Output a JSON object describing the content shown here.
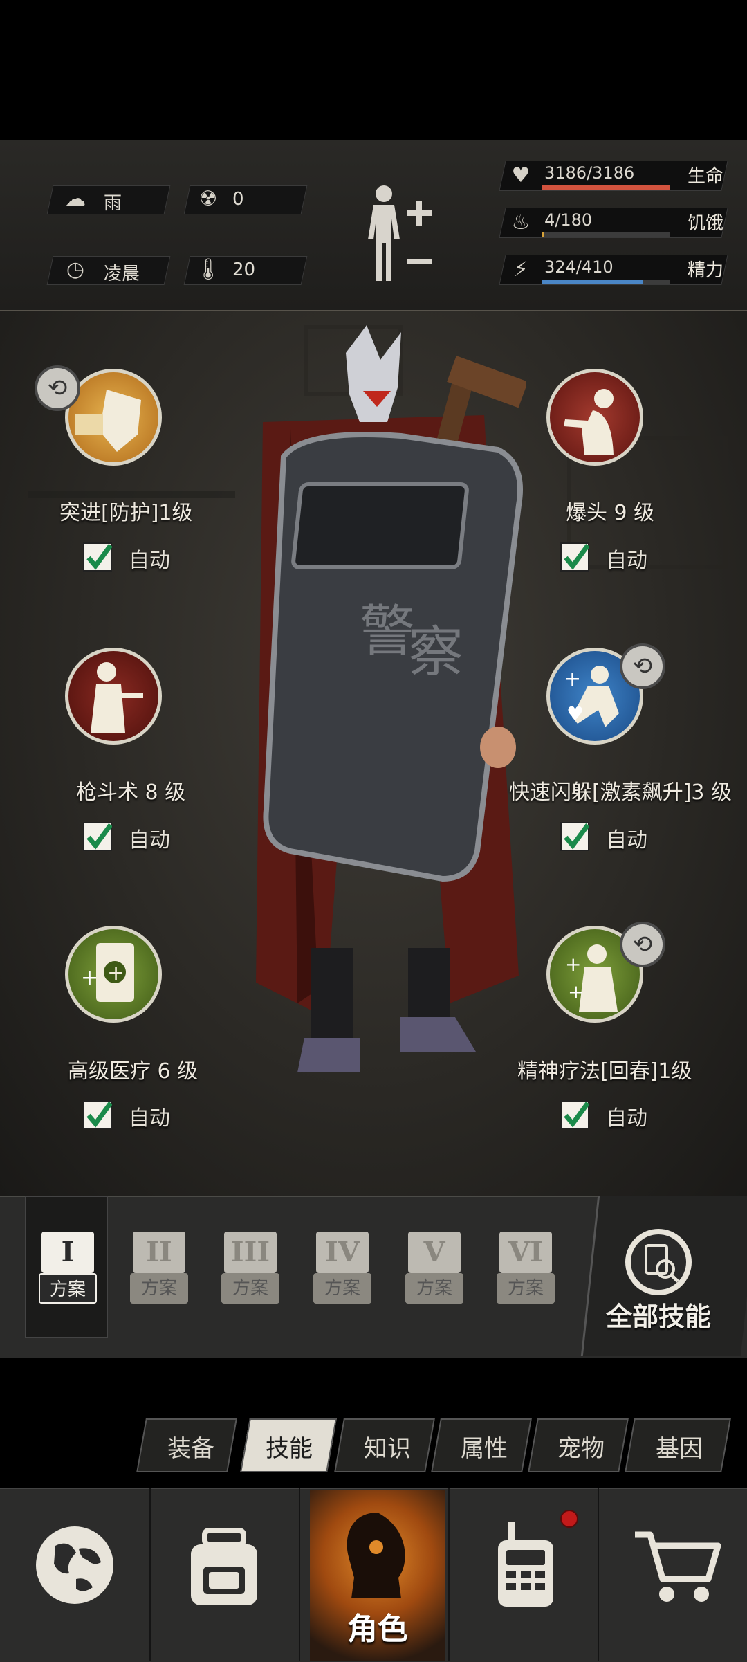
{
  "status": {
    "weather": "雨",
    "radiation": "0",
    "time_of_day": "凌晨",
    "temperature": "20",
    "health": {
      "value": "3186/3186",
      "label": "生命",
      "fraction": 1.0,
      "color": "#d2533e"
    },
    "hunger": {
      "value": "4/180",
      "label": "饥饿",
      "fraction": 0.022,
      "color": "#d6a23a"
    },
    "energy": {
      "value": "324/410",
      "label": "精力",
      "fraction": 0.79,
      "color": "#4a86c6"
    }
  },
  "skills": [
    {
      "name": "突进[防护]1级",
      "auto": "自动",
      "checked": true,
      "icon": "shield-punch-icon"
    },
    {
      "name": "爆头 9 级",
      "auto": "自动",
      "checked": true,
      "icon": "headshot-icon"
    },
    {
      "name": "枪斗术 8 级",
      "auto": "自动",
      "checked": true,
      "icon": "gun-fu-icon"
    },
    {
      "name": "快速闪躲[激素飙升]3 级",
      "auto": "自动",
      "checked": true,
      "icon": "quick-dodge-icon"
    },
    {
      "name": "高级医疗 6 级",
      "auto": "自动",
      "checked": true,
      "icon": "advanced-medical-icon"
    },
    {
      "name": "精神疗法[回春]1级",
      "auto": "自动",
      "checked": true,
      "icon": "mental-therapy-icon"
    }
  ],
  "plans": [
    {
      "roman": "I",
      "word": "方案"
    },
    {
      "roman": "II",
      "word": "方案"
    },
    {
      "roman": "III",
      "word": "方案"
    },
    {
      "roman": "IV",
      "word": "方案"
    },
    {
      "roman": "V",
      "word": "方案"
    },
    {
      "roman": "VI",
      "word": "方案"
    }
  ],
  "all_skills_label": "全部技能",
  "tabs": [
    "装备",
    "技能",
    "知识",
    "属性",
    "宠物",
    "基因"
  ],
  "active_tab": "技能",
  "nav": {
    "character_label": "角色"
  }
}
